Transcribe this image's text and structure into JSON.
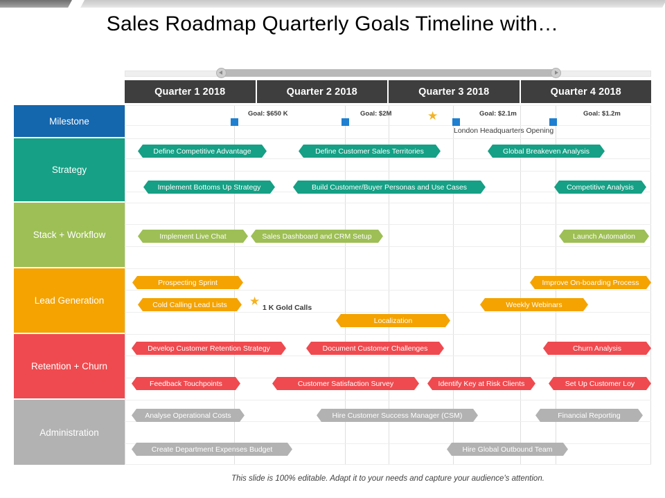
{
  "slide": {
    "title": "Sales Roadmap Quarterly Goals Timeline with…",
    "footer_note": "This slide is 100% editable. Adapt it to your needs and capture your audience's attention."
  },
  "slider": {
    "name": "timeline-range-slider",
    "left_handle_icon": "chevron-left-icon",
    "right_handle_icon": "chevron-right-icon"
  },
  "colors": {
    "milestone": "#1466ad",
    "strategy": "#16a085",
    "stack_workflow": "#9dbf55",
    "lead_generation": "#f4a300",
    "retention_churn": "#ef4a4f",
    "administration": "#b2b2b2",
    "header": "#3e3e3e",
    "marker_blue": "#1f7fd0",
    "star_gold": "#f3b323"
  },
  "columns": [
    {
      "label": "Quarter 1 2018"
    },
    {
      "label": "Quarter 2 2018"
    },
    {
      "label": "Quarter 3 2018"
    },
    {
      "label": "Quarter 4 2018"
    }
  ],
  "rows": [
    {
      "label": "Milestone",
      "color": "#1466ad"
    },
    {
      "label": "Strategy",
      "color": "#16a085"
    },
    {
      "label": "Stack + Workflow",
      "color": "#9dbf55"
    },
    {
      "label": "Lead Generation",
      "color": "#f4a300"
    },
    {
      "label": "Retention  + Churn",
      "color": "#ef4a4f"
    },
    {
      "label": "Administration",
      "color": "#b2b2b2"
    }
  ],
  "milestones": {
    "goals": [
      {
        "label": "Goal: $650 K"
      },
      {
        "label": "Goal: $2M"
      },
      {
        "label": "Goal: $2.1m"
      },
      {
        "label": "Goal: $1.2m"
      }
    ],
    "annotation": "London Headquarters Opening",
    "marker_count": 4,
    "star_count": 1
  },
  "bars": {
    "strategy": [
      {
        "label": "Define Competitive Advantage"
      },
      {
        "label": "Define Customer Sales Territories"
      },
      {
        "label": "Global Breakeven Analysis"
      },
      {
        "label": "Implement Bottoms Up Strategy"
      },
      {
        "label": "Build Customer/Buyer Personas and Use Cases"
      },
      {
        "label": "Competitive Analysis"
      }
    ],
    "stack_workflow": [
      {
        "label": "Implement Live Chat"
      },
      {
        "label": "Sales Dashboard and CRM Setup"
      },
      {
        "label": "Launch Automation"
      }
    ],
    "lead_generation": [
      {
        "label": "Prospecting Sprint"
      },
      {
        "label": "Improve On-boarding Process"
      },
      {
        "label": "Cold Calling Lead Lists"
      },
      {
        "label": "Weekly Webinars"
      },
      {
        "label": "Localization"
      }
    ],
    "retention_churn": [
      {
        "label": "Develop Customer Retention Strategy"
      },
      {
        "label": "Document Customer Challenges"
      },
      {
        "label": "Churn Analysis"
      },
      {
        "label": "Feedback Touchpoints"
      },
      {
        "label": "Customer Satisfaction Survey"
      },
      {
        "label": "Identify Key at Risk Clients"
      },
      {
        "label": "Set Up Customer Loy"
      }
    ],
    "administration": [
      {
        "label": "Analyse Operational Costs"
      },
      {
        "label": "Hire Customer Success Manager (CSM)"
      },
      {
        "label": "Financial Reporting"
      },
      {
        "label": "Create Department Expenses Budget"
      },
      {
        "label": "Hire Global Outbound Team"
      }
    ]
  },
  "annotations": {
    "gold_calls": "1 K Gold Calls"
  },
  "chart_data": {
    "type": "table",
    "title": "Sales Roadmap Quarterly Goals Timeline with…",
    "xlabel": "",
    "ylabel": "",
    "grid": true,
    "legend": "none",
    "x_categories": [
      "Quarter 1 2018",
      "Quarter 2 2018",
      "Quarter 3 2018",
      "Quarter 4 2018"
    ],
    "swimlanes": [
      {
        "name": "Milestone",
        "color": "#1466ad",
        "markers": [
          {
            "type": "square",
            "quarter": 1,
            "x_pct": 20,
            "goal_label": "Goal: $650 K"
          },
          {
            "type": "square",
            "quarter": 2,
            "x_pct": 41,
            "goal_label": "Goal: $2M"
          },
          {
            "type": "star",
            "quarter": 3,
            "x_pct": 58,
            "goal_label": ""
          },
          {
            "type": "square",
            "quarter": 3,
            "x_pct": 62,
            "goal_label": "Goal: $2.1m",
            "annotation": "London Headquarters Opening"
          },
          {
            "type": "square",
            "quarter": 4,
            "x_pct": 81,
            "goal_label": "Goal: $1.2m"
          }
        ]
      },
      {
        "name": "Strategy",
        "color": "#16a085",
        "tasks": [
          {
            "label": "Define Competitive Advantage",
            "start_pct": 2.5,
            "end_pct": 27,
            "track": 0
          },
          {
            "label": "Define Customer Sales Territories",
            "start_pct": 33,
            "end_pct": 60,
            "track": 0
          },
          {
            "label": "Global Breakeven Analysis",
            "start_pct": 69,
            "end_pct": 91,
            "track": 0
          },
          {
            "label": "Implement Bottoms Up Strategy",
            "start_pct": 3.5,
            "end_pct": 28.5,
            "track": 1
          },
          {
            "label": "Build Customer/Buyer Personas and Use Cases",
            "start_pct": 32,
            "end_pct": 68.5,
            "track": 1
          },
          {
            "label": "Competitive Analysis",
            "start_pct": 81.5,
            "end_pct": 99,
            "track": 1
          }
        ]
      },
      {
        "name": "Stack + Workflow",
        "color": "#9dbf55",
        "tasks": [
          {
            "label": "Implement Live Chat",
            "start_pct": 2.5,
            "end_pct": 23.5,
            "track": 0
          },
          {
            "label": "Sales Dashboard and CRM Setup",
            "start_pct": 24,
            "end_pct": 49,
            "track": 0
          },
          {
            "label": "Launch Automation",
            "start_pct": 82.5,
            "end_pct": 99.5,
            "track": 0
          }
        ]
      },
      {
        "name": "Lead Generation",
        "color": "#f4a300",
        "tasks": [
          {
            "label": "Prospecting Sprint",
            "start_pct": 1.5,
            "end_pct": 22.5,
            "track": 0
          },
          {
            "label": "Improve On-boarding Process",
            "start_pct": 77,
            "end_pct": 100,
            "track": 0
          },
          {
            "label": "Cold Calling Lead Lists",
            "start_pct": 2.5,
            "end_pct": 22,
            "track": 1
          },
          {
            "label": "Weekly Webinars",
            "start_pct": 67.5,
            "end_pct": 88,
            "track": 1
          },
          {
            "label": "Localization",
            "start_pct": 40,
            "end_pct": 62,
            "track": 2
          }
        ],
        "markers": [
          {
            "type": "star",
            "x_pct": 23.5,
            "annotation": "1 K Gold Calls"
          }
        ]
      },
      {
        "name": "Retention  + Churn",
        "color": "#ef4a4f",
        "tasks": [
          {
            "label": "Develop Customer Retention Strategy",
            "start_pct": 1.5,
            "end_pct": 31,
            "track": 0
          },
          {
            "label": "Document Customer Challenges",
            "start_pct": 34.5,
            "end_pct": 61,
            "track": 0
          },
          {
            "label": "Churn Analysis",
            "start_pct": 79.5,
            "end_pct": 100,
            "track": 0
          },
          {
            "label": "Feedback Touchpoints",
            "start_pct": 1.5,
            "end_pct": 22,
            "track": 1
          },
          {
            "label": "Customer Satisfaction Survey",
            "start_pct": 28,
            "end_pct": 56,
            "track": 1
          },
          {
            "label": "Identify Key at Risk Clients",
            "start_pct": 57.5,
            "end_pct": 78,
            "track": 1
          },
          {
            "label": "Set Up Customer Loy",
            "start_pct": 80.5,
            "end_pct": 100,
            "track": 1
          }
        ]
      },
      {
        "name": "Administration",
        "color": "#b2b2b2",
        "tasks": [
          {
            "label": "Analyse Operational Costs",
            "start_pct": 1.5,
            "end_pct": 23,
            "track": 0
          },
          {
            "label": "Hire Customer Success Manager (CSM)",
            "start_pct": 36.5,
            "end_pct": 67,
            "track": 0
          },
          {
            "label": "Financial Reporting",
            "start_pct": 78,
            "end_pct": 99,
            "track": 0
          },
          {
            "label": "Create Department Expenses Budget",
            "start_pct": 1.5,
            "end_pct": 32,
            "track": 1
          },
          {
            "label": "Hire Global Outbound Team",
            "start_pct": 61,
            "end_pct": 84,
            "track": 1
          }
        ]
      }
    ]
  }
}
